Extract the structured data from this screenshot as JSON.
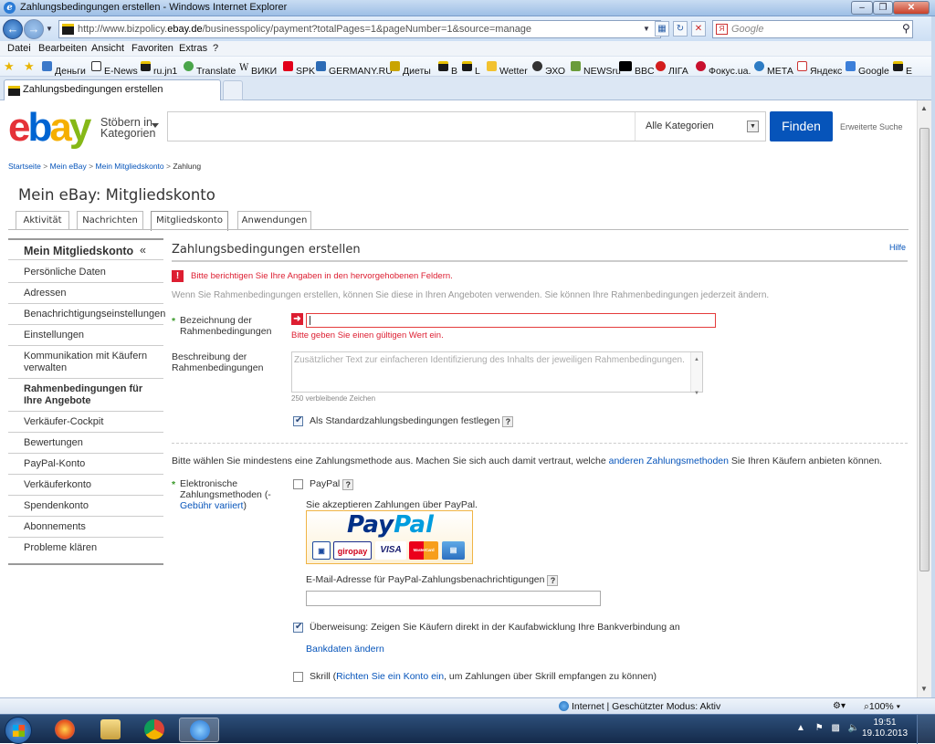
{
  "browser": {
    "window_title": "Zahlungsbedingungen erstellen - Windows Internet Explorer",
    "url_pre": "http://www.bizpolicy.",
    "url_host": "ebay.de",
    "url_post": "/businesspolicy/payment?totalPages=1&pageNumber=1&source=manage",
    "search_placeholder": "Google",
    "menu": [
      "Datei",
      "Bearbeiten",
      "Ansicht",
      "Favoriten",
      "Extras",
      "?"
    ],
    "favorites": [
      "Деньги",
      "E-News",
      "ru.jn1",
      "Translate",
      "ВИКИ",
      "SPK",
      "GERMANY.RU",
      "Диеты",
      "B",
      "L",
      "Wetter",
      "ЭХО",
      "NEWSru",
      "BBC",
      "ЛІГА",
      "Фокус.ua.",
      "МЕТА",
      "Яндекс",
      "Google",
      "E"
    ],
    "tab_title": "Zahlungsbedingungen erstellen",
    "status_zone": "Internet | Geschützter Modus: Aktiv",
    "zoom": "100%",
    "clock_time": "19:51",
    "clock_date": "19.10.2013",
    "colors": {
      "ebay_red": "#e53238",
      "ebay_blue": "#0064d2",
      "ebay_yellow": "#f5af02",
      "ebay_green": "#86b817",
      "error_red": "#dd1e31",
      "link_blue": "#0654ba"
    }
  },
  "header": {
    "logo": {
      "e": "e",
      "b": "b",
      "a": "a",
      "y": "y"
    },
    "browse_line1": "Stöbern in",
    "browse_line2": "Kategorien",
    "search_value": "",
    "category": "Alle Kategorien",
    "find_button": "Finden",
    "advanced_search": "Erweiterte Suche"
  },
  "breadcrumb": {
    "items": [
      "Startseite",
      "Mein eBay",
      "Mein Mitgliedskonto"
    ],
    "separator": ">",
    "current": "Zahlung"
  },
  "page_title": "Mein eBay: Mitgliedskonto",
  "tabs": [
    "Aktivität",
    "Nachrichten",
    "Mitgliedskonto",
    "Anwendungen"
  ],
  "selected_tab": "Mitgliedskonto",
  "sidebar": {
    "title": "Mein Mitgliedskonto",
    "collapse": "«",
    "items": [
      {
        "label": "Persönliche Daten"
      },
      {
        "label": "Adressen"
      },
      {
        "label": "Benachrichtigungseinstellungen"
      },
      {
        "label": "Einstellungen"
      },
      {
        "label": "Kommunikation mit Käufern verwalten"
      },
      {
        "label": "Rahmenbedingungen für Ihre Angebote"
      },
      {
        "label": "Verkäufer-Cockpit"
      },
      {
        "label": "Bewertungen"
      },
      {
        "label": "PayPal-Konto"
      },
      {
        "label": "Verkäuferkonto"
      },
      {
        "label": "Spendenkonto"
      },
      {
        "label": "Abonnements"
      },
      {
        "label": "Probleme klären"
      }
    ],
    "active_item": "Rahmenbedingungen für Ihre Angebote"
  },
  "form": {
    "title": "Zahlungsbedingungen erstellen",
    "help": "Hilfe",
    "error_banner": "Bitte berichtigen Sie Ihre Angaben in den hervorgehobenen Feldern.",
    "intro": "Wenn Sie Rahmenbedingungen erstellen, können Sie diese in Ihren Angeboten verwenden. Sie können Ihre Rahmenbedingungen jederzeit ändern.",
    "required_marker": "*",
    "name_label_1": "Bezeichnung der",
    "name_label_2": "Rahmenbedingungen",
    "name_value": "",
    "name_error": "Bitte geben Sie einen gültigen Wert ein.",
    "desc_label_1": "Beschreibung der",
    "desc_label_2": "Rahmenbedingungen",
    "desc_placeholder": "Zusätzlicher Text zur einfacheren Identifizierung des Inhalts der jeweiligen Rahmenbedingungen.",
    "char_count": "250 verbleibende Zeichen",
    "default_checkbox_label": "Als Standardzahlungsbedingungen festlegen",
    "default_checked": true,
    "help_glyph": "?"
  },
  "payment": {
    "instructions_pre": "Bitte wählen Sie mindestens eine Zahlungsmethode aus. Machen Sie sich auch damit vertraut, welche",
    "instructions_link": "anderen Zahlungsmethoden",
    "instructions_post": "Sie Ihren Käufern anbieten können.",
    "label_1": "Elektronische",
    "label_2": "Zahlungsmethoden (-",
    "label_link": "Gebühr variiert",
    "label_close": ")",
    "paypal_label": "PayPal",
    "paypal_checked": false,
    "paypal_desc": "Sie akzeptieren Zahlungen über PayPal.",
    "paypal_logo_1": "Pay",
    "paypal_logo_2": "Pal",
    "paypal_cards": [
      "giropay",
      "VISA",
      "MasterCard"
    ],
    "email_label": "E-Mail-Adresse für PayPal-Zahlungsbenachrichtigungen",
    "email_value": "",
    "transfer_checked": true,
    "transfer_label": "Überweisung: Zeigen Sie Käufern direkt in der Kaufabwicklung Ihre Bankverbindung an",
    "bank_link": "Bankdaten ändern",
    "skrill_checked": false,
    "skrill_pre": "Skrill (",
    "skrill_link": "Richten Sie ein Konto ein",
    "skrill_post": ", um Zahlungen über Skrill empfangen zu können)"
  }
}
